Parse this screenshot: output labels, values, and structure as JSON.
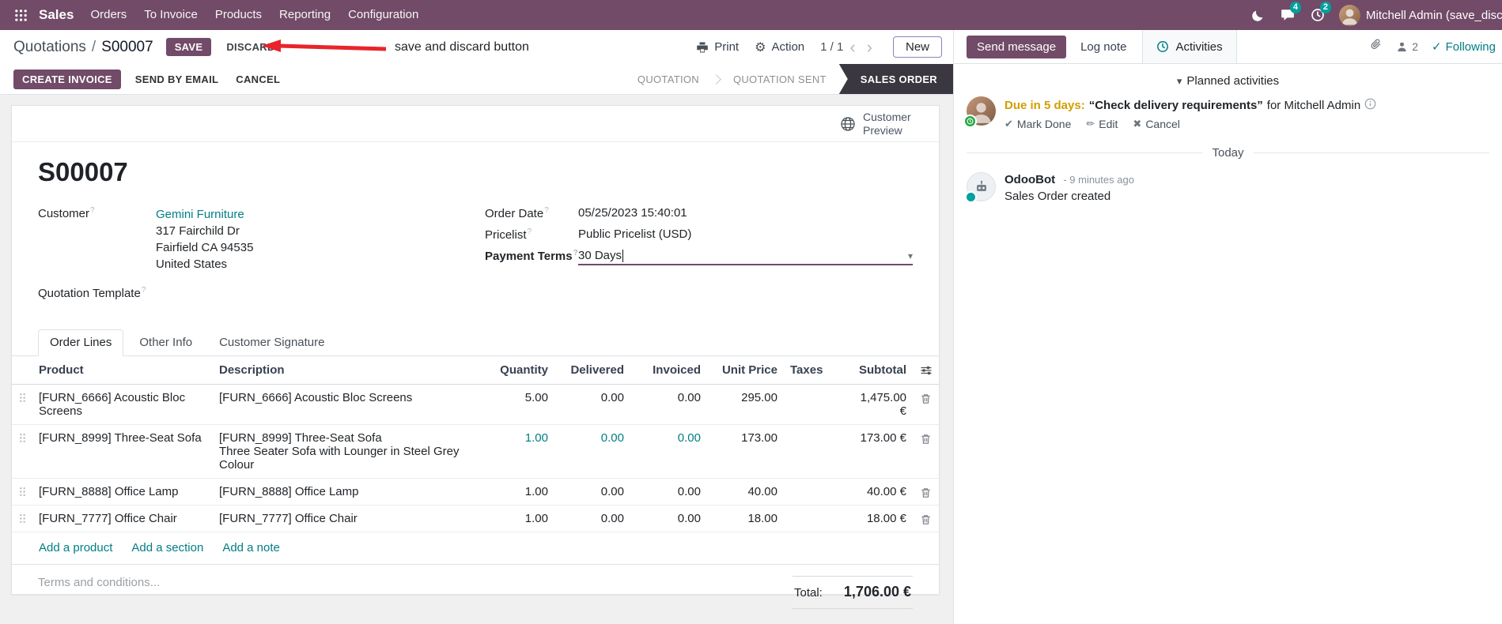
{
  "navbar": {
    "app_name": "Sales",
    "menus": [
      "Orders",
      "To Invoice",
      "Products",
      "Reporting",
      "Configuration"
    ],
    "messages_badge": "4",
    "activities_badge": "2",
    "user": "Mitchell Admin (save_discar"
  },
  "breadcrumb": {
    "parent": "Quotations",
    "separator": "/",
    "current": "S00007",
    "save_label": "SAVE",
    "discard_label": "DISCARD",
    "annotation": "save and discard button",
    "print_label": "Print",
    "action_label": "Action",
    "pager": "1 / 1",
    "new_label": "New"
  },
  "action_bar": {
    "create_invoice": "CREATE INVOICE",
    "send_by_email": "SEND BY EMAIL",
    "cancel": "CANCEL",
    "statuses": [
      {
        "label": "QUOTATION",
        "active": false
      },
      {
        "label": "QUOTATION SENT",
        "active": false
      },
      {
        "label": "SALES ORDER",
        "active": true
      }
    ]
  },
  "sheet": {
    "customer_preview": "Customer Preview",
    "title": "S00007",
    "fields": {
      "customer_label": "Customer",
      "customer_value": "Gemini Furniture",
      "address": [
        "317 Fairchild Dr",
        "Fairfield CA 94535",
        "United States"
      ],
      "quotation_template_label": "Quotation Template",
      "order_date_label": "Order Date",
      "order_date_value": "05/25/2023 15:40:01",
      "pricelist_label": "Pricelist",
      "pricelist_value": "Public Pricelist (USD)",
      "payment_terms_label": "Payment Terms",
      "payment_terms_value": "30 Days"
    },
    "tabs": [
      {
        "label": "Order Lines"
      },
      {
        "label": "Other Info"
      },
      {
        "label": "Customer Signature"
      }
    ],
    "table": {
      "headers": [
        "Product",
        "Description",
        "Quantity",
        "Delivered",
        "Invoiced",
        "Unit Price",
        "Taxes",
        "Subtotal"
      ],
      "rows": [
        {
          "product": "[FURN_6666] Acoustic Bloc Screens",
          "description": "[FURN_6666] Acoustic Bloc Screens",
          "description2": "",
          "quantity": "5.00",
          "delivered": "0.00",
          "invoiced": "0.00",
          "unit_price": "295.00",
          "taxes": "",
          "subtotal": "1,475.00 €"
        },
        {
          "product": "[FURN_8999] Three-Seat Sofa",
          "description": "[FURN_8999] Three-Seat Sofa",
          "description2": "Three Seater Sofa with Lounger in Steel Grey Colour",
          "quantity": "1.00",
          "delivered": "0.00",
          "invoiced": "0.00",
          "unit_price": "173.00",
          "taxes": "",
          "subtotal": "173.00 €"
        },
        {
          "product": "[FURN_8888] Office Lamp",
          "description": "[FURN_8888] Office Lamp",
          "description2": "",
          "quantity": "1.00",
          "delivered": "0.00",
          "invoiced": "0.00",
          "unit_price": "40.00",
          "taxes": "",
          "subtotal": "40.00 €"
        },
        {
          "product": "[FURN_7777] Office Chair",
          "description": "[FURN_7777] Office Chair",
          "description2": "",
          "quantity": "1.00",
          "delivered": "0.00",
          "invoiced": "0.00",
          "unit_price": "18.00",
          "taxes": "",
          "subtotal": "18.00 €"
        }
      ],
      "links": [
        "Add a product",
        "Add a section",
        "Add a note"
      ],
      "terms_placeholder": "Terms and conditions...",
      "total_label": "Total:",
      "total_value": "1,706.00 €"
    }
  },
  "chatter": {
    "send_message": "Send message",
    "log_note": "Log note",
    "activities": "Activities",
    "followers_count": "2",
    "following": "Following",
    "planned_header": "Planned activities",
    "activity": {
      "due": "Due in 5 days:",
      "summary": "“Check delivery requirements”",
      "for_text": "for Mitchell Admin",
      "mark_done": "Mark Done",
      "edit": "Edit",
      "cancel": "Cancel"
    },
    "today": "Today",
    "message": {
      "author": "OdooBot",
      "time": "- 9 minutes ago",
      "body": "Sales Order created"
    }
  },
  "icons": {
    "help_marker": "?",
    "gear": "⚙",
    "caret_down": "▾",
    "chevron_left": "‹",
    "chevron_right": "›",
    "check": "✔",
    "check_light": "✓",
    "pencil": "✏",
    "cross": "✖"
  },
  "colors": {
    "primary": "#714B67",
    "link": "#017e84",
    "annotation_red": "#e8252b",
    "status_active_bg": "#3b3741",
    "due_warning": "#d39e00",
    "badge": "#00a09d"
  }
}
